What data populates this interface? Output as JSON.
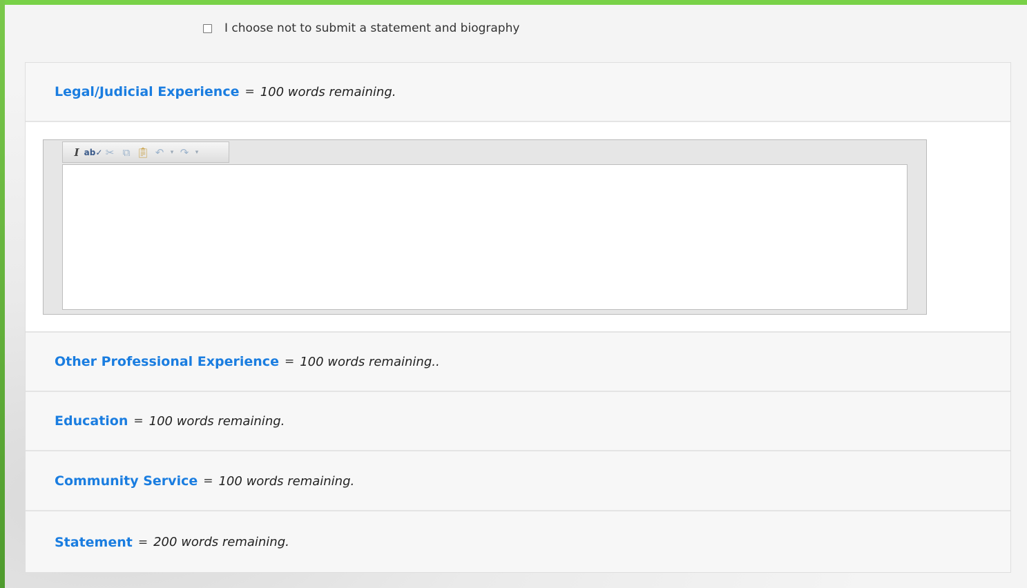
{
  "optout": {
    "label": "I choose not to submit a statement and biography",
    "checked": false
  },
  "sections": [
    {
      "label": "Legal/Judicial Experience",
      "eq": "=",
      "remaining": "100 words remaining."
    },
    {
      "label": "Other Professional Experience",
      "eq": "=",
      "remaining": "100 words remaining.."
    },
    {
      "label": "Education",
      "eq": "=",
      "remaining": "100 words remaining."
    },
    {
      "label": "Community Service",
      "eq": "=",
      "remaining": "100 words remaining."
    },
    {
      "label": "Statement",
      "eq": "=",
      "remaining": "200 words remaining."
    }
  ],
  "toolbar_icons": [
    "italic-icon",
    "spellcheck-icon",
    "cut-icon",
    "copy-icon",
    "paste-icon",
    "undo-icon",
    "undo-dropdown-icon",
    "redo-icon",
    "redo-dropdown-icon"
  ],
  "colors": {
    "accent_link": "#1a7de0",
    "frame_green": "#78d147"
  }
}
